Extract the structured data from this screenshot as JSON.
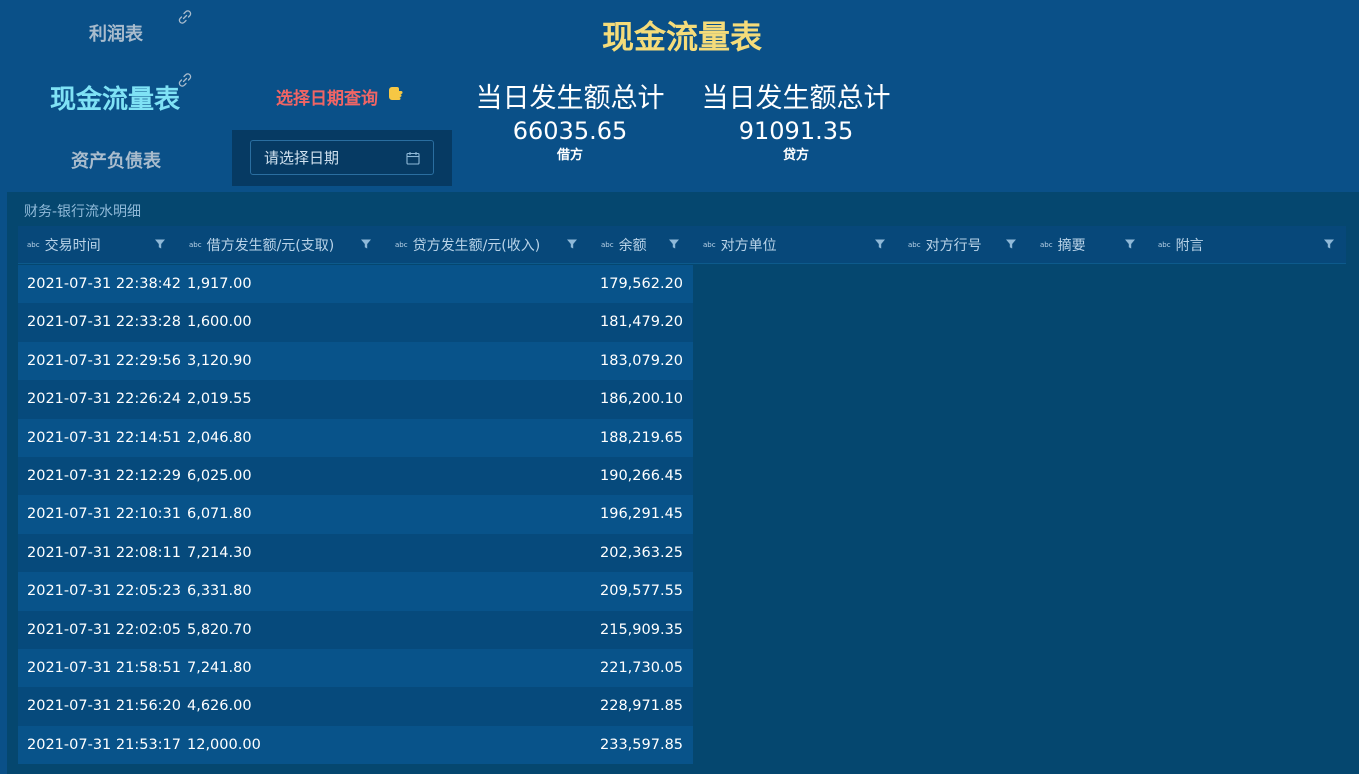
{
  "nav": {
    "profit": "利润表",
    "cash": "现金流量表",
    "balance": "资产负债表"
  },
  "title": "现金流量表",
  "date_query": {
    "label": "选择日期查询",
    "placeholder": "请选择日期"
  },
  "stats": [
    {
      "title": "当日发生额总计",
      "value": "66035.65",
      "sub": "借方"
    },
    {
      "title": "当日发生额总计",
      "value": "91091.35",
      "sub": "贷方"
    }
  ],
  "table": {
    "title": "财务-银行流水明细",
    "columns": [
      "交易时间",
      "借方发生额/元(支取)",
      "贷方发生额/元(收入)",
      "余额",
      "对方单位",
      "对方行号",
      "摘要",
      "附言"
    ],
    "column_type_label": "abc",
    "rows": [
      {
        "time": "2021-07-31 22:38:42",
        "debit": "1,917.00",
        "balance": "179,562.20"
      },
      {
        "time": "2021-07-31 22:33:28",
        "debit": "1,600.00",
        "balance": "181,479.20"
      },
      {
        "time": "2021-07-31 22:29:56",
        "debit": "3,120.90",
        "balance": "183,079.20"
      },
      {
        "time": "2021-07-31 22:26:24",
        "debit": "2,019.55",
        "balance": "186,200.10"
      },
      {
        "time": "2021-07-31 22:14:51",
        "debit": "2,046.80",
        "balance": "188,219.65"
      },
      {
        "time": "2021-07-31 22:12:29",
        "debit": "6,025.00",
        "balance": "190,266.45"
      },
      {
        "time": "2021-07-31 22:10:31",
        "debit": "6,071.80",
        "balance": "196,291.45"
      },
      {
        "time": "2021-07-31 22:08:11",
        "debit": "7,214.30",
        "balance": "202,363.25"
      },
      {
        "time": "2021-07-31 22:05:23",
        "debit": "6,331.80",
        "balance": "209,577.55"
      },
      {
        "time": "2021-07-31 22:02:05",
        "debit": "5,820.70",
        "balance": "215,909.35"
      },
      {
        "time": "2021-07-31 21:58:51",
        "debit": "7,241.80",
        "balance": "221,730.05"
      },
      {
        "time": "2021-07-31 21:56:20",
        "debit": "4,626.00",
        "balance": "228,971.85"
      },
      {
        "time": "2021-07-31 21:53:17",
        "debit": "12,000.00",
        "balance": "233,597.85"
      }
    ]
  },
  "icons": {
    "link": "link-icon",
    "hand": "pointing-down-hand-icon",
    "calendar": "calendar-icon",
    "filter": "filter-icon"
  },
  "colors": {
    "background": "#0a5088",
    "title": "#f5dc7a",
    "active_nav": "#7fe2f5",
    "inactive_nav": "#a9bccd",
    "date_label": "#f06565"
  }
}
